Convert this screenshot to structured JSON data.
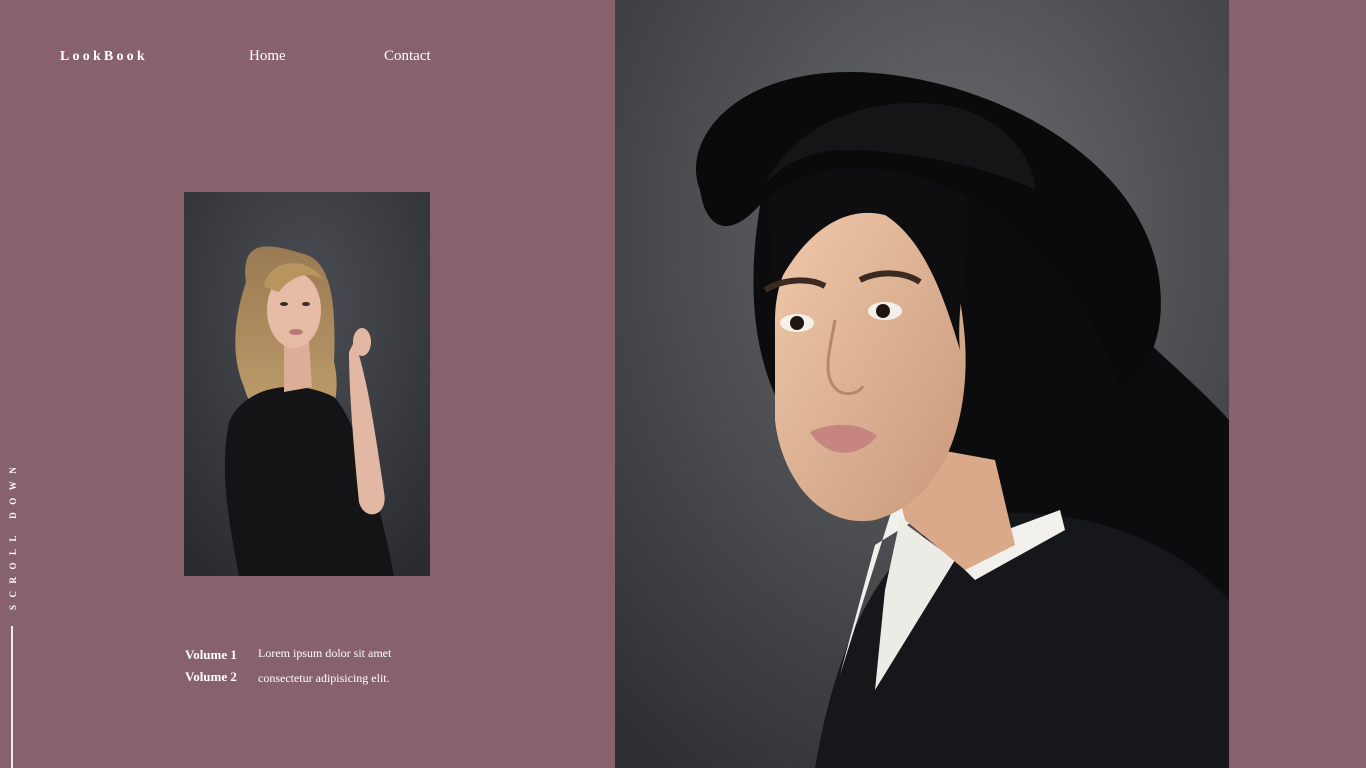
{
  "header": {
    "brand": "LookBook",
    "nav": [
      {
        "label": "Home"
      },
      {
        "label": "Contact"
      }
    ]
  },
  "sidebar": {
    "scroll_label": "SCROLL DOWN"
  },
  "volumes": [
    {
      "label": "Volume 1",
      "text": "Lorem ipsum dolor sit amet"
    },
    {
      "label": "Volume 2",
      "text": "consectetur adipisicing elit."
    }
  ],
  "colors": {
    "background": "#87616c",
    "text": "#ffffff",
    "photo_backdrop": "#45474b"
  }
}
